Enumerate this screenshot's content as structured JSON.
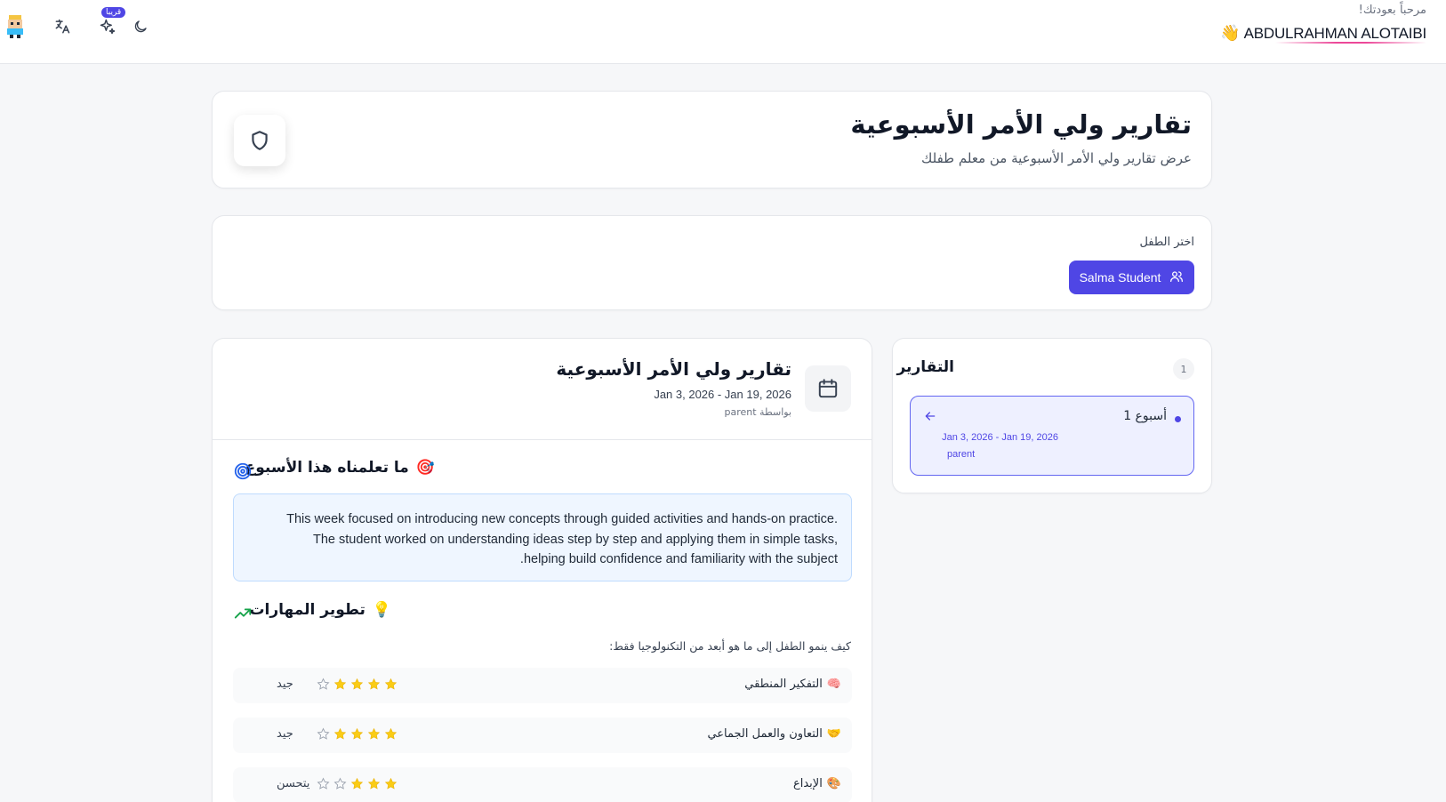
{
  "header": {
    "greeting": "مرحباً بعودتك!",
    "user_name": "ABDULRAHMAN ALOTAIBI",
    "wave_emoji": "👋",
    "soon_badge": "قريبا",
    "icons": [
      "avatar-icon",
      "translate-icon",
      "sparkles-icon",
      "moon-icon"
    ]
  },
  "hero": {
    "title": "تقارير ولي الأمر الأسبوعية",
    "subtitle": "عرض تقارير ولي الأمر الأسبوعية من معلم طفلك",
    "icon": "shield-icon"
  },
  "child_selector": {
    "label": "اختر الطفل",
    "selected_child": "Salma Student",
    "accent": "#4f46e5"
  },
  "reports_list": {
    "title": "التقارير",
    "count": "1",
    "items": [
      {
        "name": "أسبوع 1",
        "range": "Jan 3, 2026 - Jan 19, 2026",
        "by": "parent"
      }
    ]
  },
  "report_detail": {
    "title": "تقارير ولي الأمر الأسبوعية",
    "range": "Jan 3, 2026 - Jan 19, 2026",
    "by": "بواسطة parent",
    "learned": {
      "emoji": "🎯",
      "title": "ما تعلمناه هذا الأسبوع",
      "text": "This week focused on introducing new concepts through guided activities and hands-on practice. The student worked on understanding ideas step by step and applying them in simple tasks, helping build confidence and familiarity with the subject."
    },
    "skills": {
      "emoji": "💡",
      "title": "تطوير المهارات",
      "subtitle": "كيف ينمو الطفل إلى ما هو أبعد من التكنولوجيا فقط:",
      "items": [
        {
          "emoji": "🧠",
          "name": "التفكير المنطقي",
          "stars": 4,
          "max": 5,
          "level": "جيد"
        },
        {
          "emoji": "🤝",
          "name": "التعاون والعمل الجماعي",
          "stars": 4,
          "max": 5,
          "level": "جيد"
        },
        {
          "emoji": "🎨",
          "name": "الإبداع",
          "stars": 3,
          "max": 5,
          "level": "يتحسن"
        }
      ]
    }
  }
}
